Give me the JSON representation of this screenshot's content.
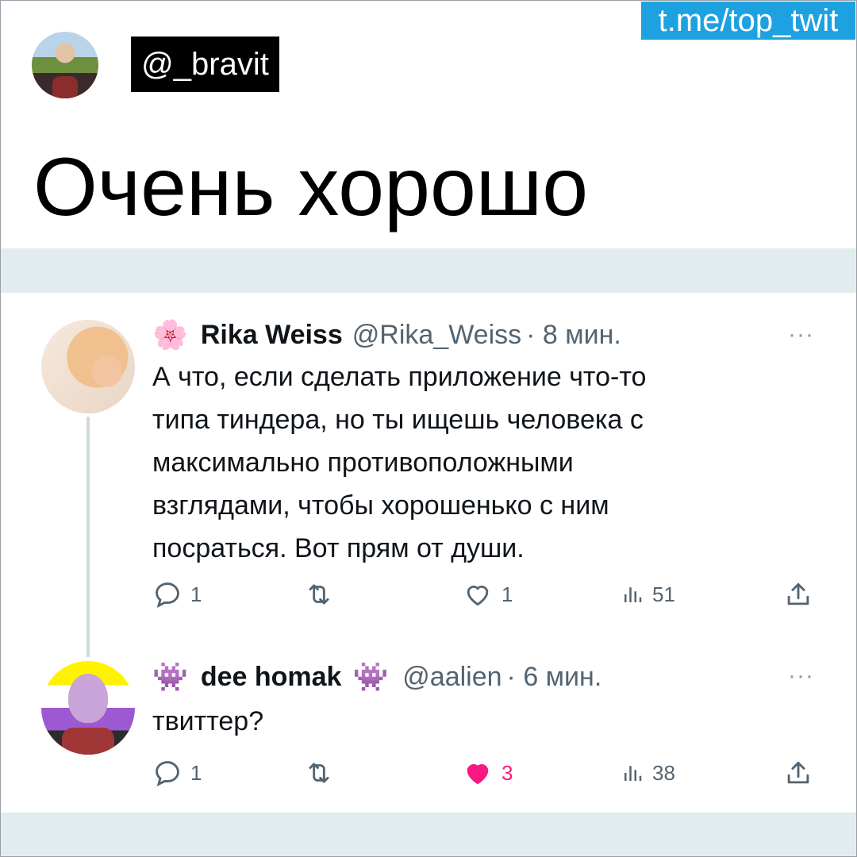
{
  "channel": {
    "label": "t.me/top_twit"
  },
  "post": {
    "author_handle": "@_bravit",
    "headline": "Очень хорошо"
  },
  "tweets": [
    {
      "emoji_left": "🌸",
      "display_name": "Rika Weiss",
      "emoji_right": "",
      "handle": "@Rika_Weiss",
      "time": "· 8 мин.",
      "more": "···",
      "text": "А что, если сделать приложение что-то\nтипа тиндера, но ты ищешь человека с\nмаксимально противоположными\nвзглядами, чтобы хорошенько с ним\nпосраться. Вот прям от души.",
      "replies": "1",
      "retweets": "",
      "likes": "1",
      "views": "51",
      "liked": false
    },
    {
      "emoji_left": "👾",
      "display_name": "dee homak",
      "emoji_right": "👾",
      "handle": "@aalien",
      "time": "· 6 мин.",
      "more": "···",
      "text": "твиттер?",
      "replies": "1",
      "retweets": "",
      "likes": "3",
      "views": "38",
      "liked": true
    }
  ],
  "colors": {
    "channel_tag": "#1da1e0",
    "band": "#e1ecee",
    "like_active": "#f91880",
    "muted": "#536471"
  },
  "icons": [
    "reply-icon",
    "retweet-icon",
    "heart-icon",
    "views-icon",
    "share-icon",
    "more-icon"
  ]
}
